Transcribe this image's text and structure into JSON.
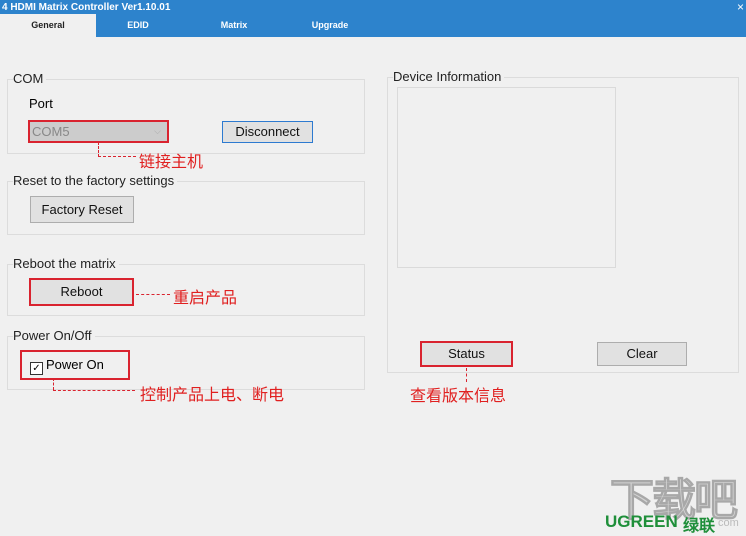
{
  "window": {
    "title": "4 HDMI Matrix Controller Ver1.10.01",
    "close": "×"
  },
  "tabs": [
    {
      "label": "General"
    },
    {
      "label": "EDID"
    },
    {
      "label": "Matrix"
    },
    {
      "label": "Upgrade"
    }
  ],
  "com": {
    "title": "COM",
    "port_label": "Port",
    "port_value": "COM5",
    "disconnect": "Disconnect",
    "annotation": "链接主机"
  },
  "reset": {
    "title": "Reset to the factory settings",
    "button": "Factory Reset"
  },
  "reboot": {
    "title": "Reboot the matrix",
    "button": "Reboot",
    "annotation": "重启产品"
  },
  "power": {
    "title": "Power On/Off",
    "checkbox": "Power On",
    "checked": true,
    "annotation": "控制产品上电、断电"
  },
  "device": {
    "title": "Device Information",
    "status": "Status",
    "clear": "Clear",
    "annotation": "查看版本信息"
  },
  "watermark": {
    "brand": "UGREEN",
    "brand_cn": "绿联",
    "site": "下载吧",
    "suffix": "com"
  },
  "colors": {
    "accent": "#2d83cc",
    "annotation": "#e02020"
  }
}
